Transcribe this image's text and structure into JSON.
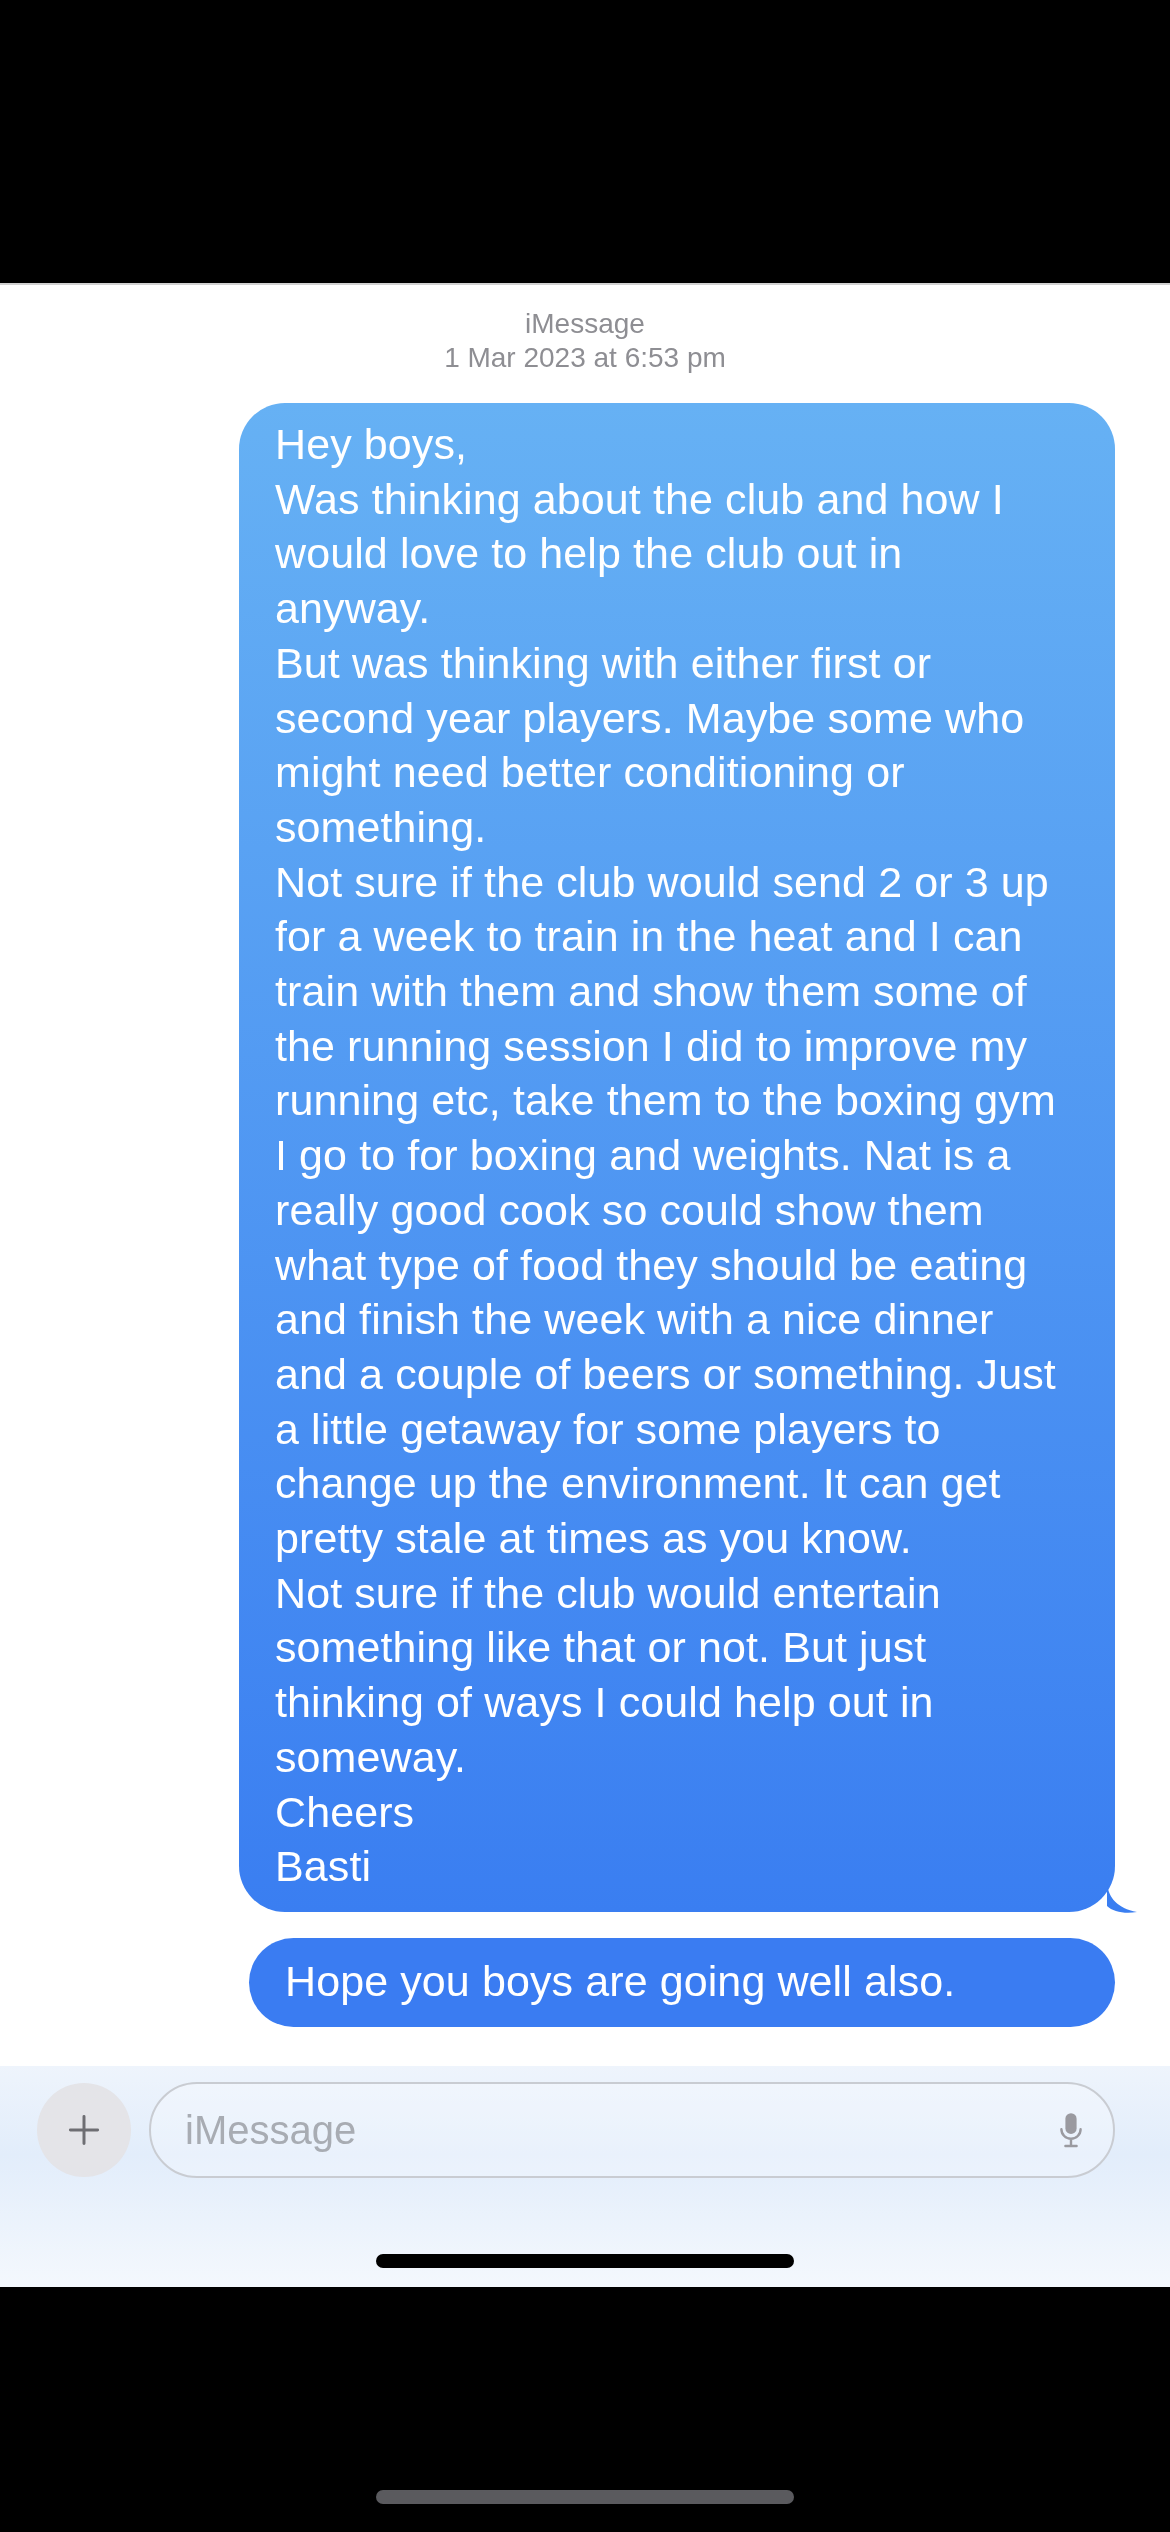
{
  "header": {
    "service": "iMessage",
    "timestamp": "1 Mar 2023 at 6:53 pm"
  },
  "messages": [
    {
      "kind": "sent",
      "tail": true,
      "paragraphs": [
        "Hey boys,",
        "Was thinking about the club and how I would love to help the club out in anyway.",
        "But was thinking with either first or second year players. Maybe some who might need better conditioning or something.",
        "Not sure if the club would send 2 or 3 up for a week to train in the heat and I can train with them and show them some of the running session I did to improve my running etc, take them to the boxing gym I go to for boxing and weights. Nat is a really good cook so could show them what type of food they should be eating and finish the week with a nice dinner and a couple of beers or something. Just a little getaway for some players to change up the environment. It can get pretty stale at times as you know.",
        "Not sure if the club would entertain something like that or not. But just thinking of ways I could help out in someway.",
        "Cheers",
        "Basti"
      ]
    },
    {
      "kind": "sent-cut",
      "tail": false,
      "paragraphs": [
        "Hope you boys are going well also."
      ]
    }
  ],
  "composer": {
    "placeholder": "iMessage"
  }
}
